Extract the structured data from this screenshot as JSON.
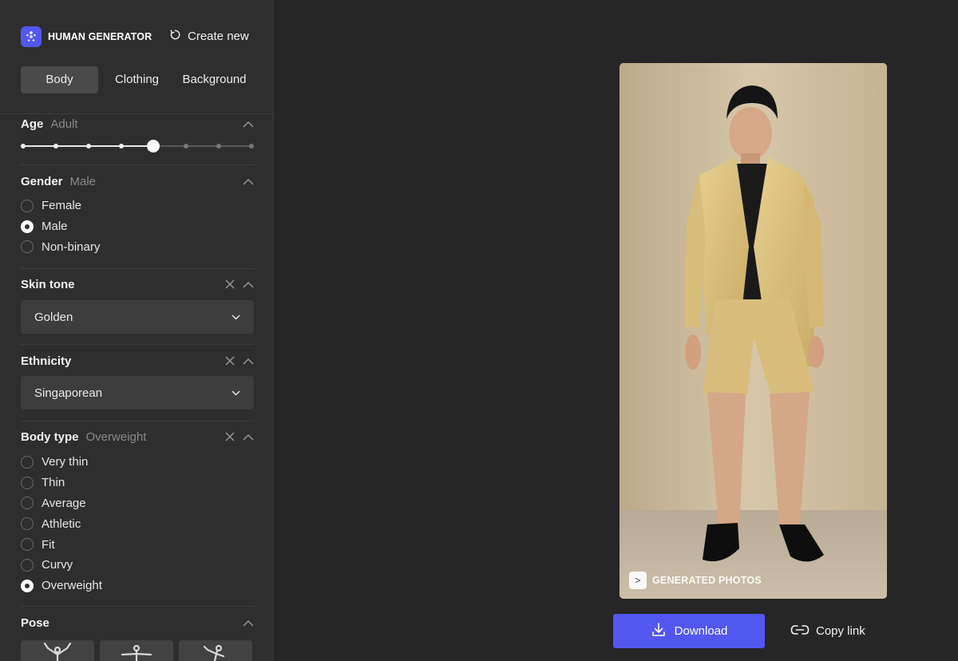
{
  "app": {
    "brand": "HUMAN GENERATOR",
    "create_new": "Create new",
    "accent_color": "#5257F0"
  },
  "tabs": [
    {
      "label": "Body",
      "active": true
    },
    {
      "label": "Clothing",
      "active": false
    },
    {
      "label": "Background",
      "active": false
    }
  ],
  "sections": {
    "age": {
      "title": "Age",
      "value": "Adult",
      "steps": 8,
      "selected_step": 4
    },
    "gender": {
      "title": "Gender",
      "value": "Male",
      "options": [
        "Female",
        "Male",
        "Non-binary"
      ],
      "selected": "Male"
    },
    "skin_tone": {
      "title": "Skin tone",
      "selected": "Golden"
    },
    "ethnicity": {
      "title": "Ethnicity",
      "selected": "Singaporean"
    },
    "body_type": {
      "title": "Body type",
      "value": "Overweight",
      "options": [
        "Very thin",
        "Thin",
        "Average",
        "Athletic",
        "Fit",
        "Curvy",
        "Overweight"
      ],
      "selected": "Overweight"
    },
    "pose": {
      "title": "Pose"
    }
  },
  "photo": {
    "watermark": "GENERATED PHOTOS",
    "watermark_icon_glyph": ">"
  },
  "actions": {
    "download": "Download",
    "copy_link": "Copy link"
  },
  "icons": {
    "logo": "human-generator-logo-icon",
    "create_new": "refresh-icon",
    "collapse": "chevron-up-icon",
    "clear": "close-icon",
    "dropdown": "chevron-down-icon",
    "download": "download-icon",
    "copy_link": "link-icon"
  }
}
